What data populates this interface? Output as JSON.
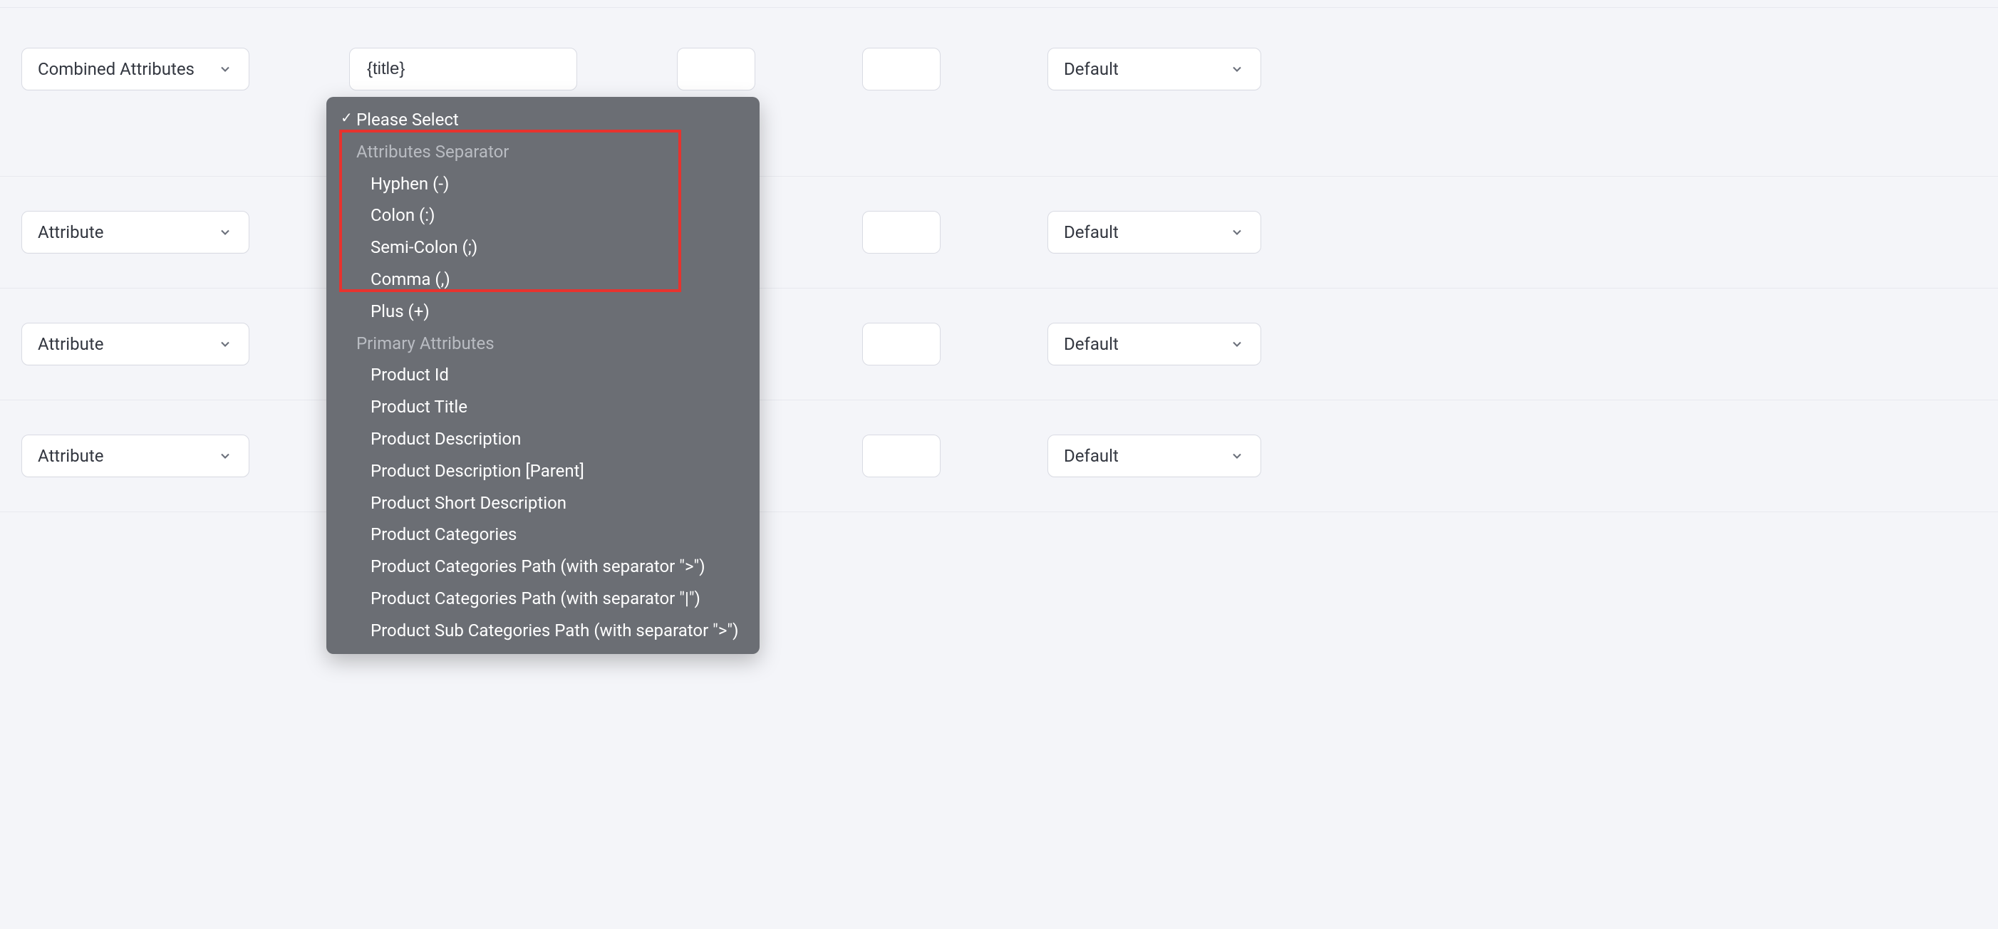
{
  "rows": [
    {
      "attribute_label": "Combined Attributes",
      "text_value": "{title}",
      "right_label": "Default"
    },
    {
      "attribute_label": "Attribute",
      "right_label": "Default"
    },
    {
      "attribute_label": "Attribute",
      "right_label": "Default"
    },
    {
      "attribute_label": "Attribute",
      "right_label": "Default"
    }
  ],
  "dropdown": {
    "selected": "Please Select",
    "groups": [
      {
        "label": "Attributes Separator",
        "items": [
          "Hyphen (-)",
          "Colon (:)",
          "Semi-Colon (;)",
          "Comma (,)",
          "Plus (+)"
        ]
      },
      {
        "label": "Primary Attributes",
        "items": [
          "Product Id",
          "Product Title",
          "Product Description",
          "Product Description [Parent]",
          "Product Short Description",
          "Product Categories",
          "Product Categories Path (with separator \">\")",
          "Product Categories Path (with separator \"|\")",
          "Product Sub Categories Path (with separator \">\")"
        ]
      }
    ]
  }
}
